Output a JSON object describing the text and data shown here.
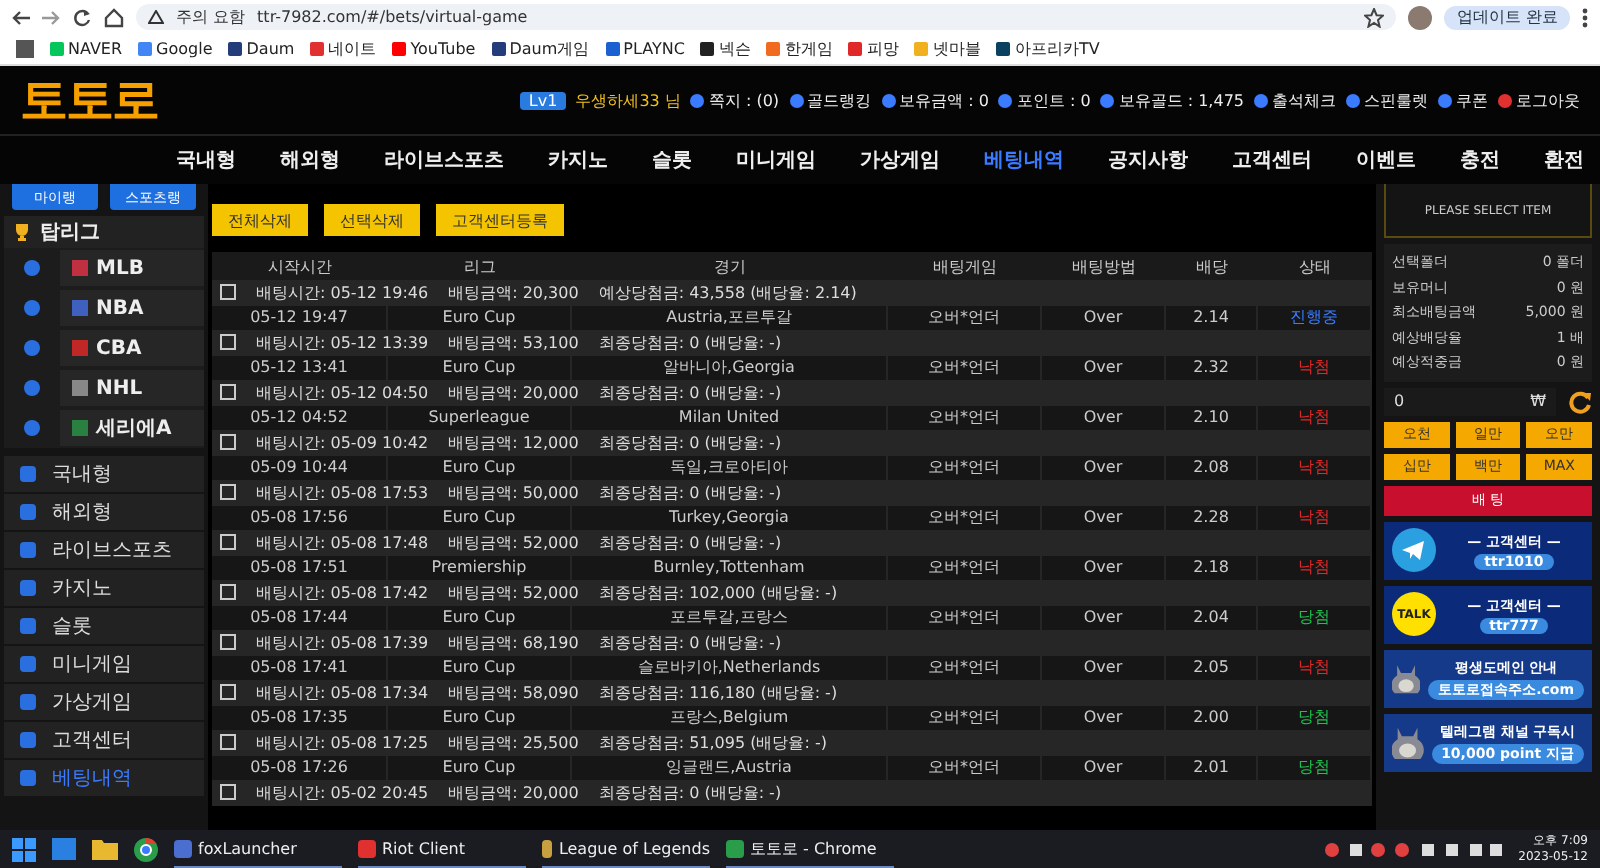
{
  "browser": {
    "security": "주의 요함",
    "url": "ttr-7982.com/#/bets/virtual-game",
    "update_button": "업데이트 완료"
  },
  "bookmarks": [
    "NAVER",
    "Google",
    "Daum",
    "네이트",
    "YouTube",
    "Daum게임",
    "PLAYNC",
    "넥슨",
    "한게임",
    "피망",
    "넷마블",
    "아프리카TV"
  ],
  "site": {
    "logo": "토토로",
    "level": "Lv1",
    "user": "우생하세33 님",
    "links": [
      {
        "text": "쪽지 : (0)",
        "kind": "mail"
      },
      {
        "text": "골드랭킹",
        "kind": "rank"
      },
      {
        "text": "보유금액 : 0",
        "kind": "coin"
      },
      {
        "text": "포인트 : 0",
        "kind": "coin"
      },
      {
        "text": "보유골드 : 1,475",
        "kind": "coin"
      },
      {
        "text": "출석체크",
        "kind": "calendar"
      },
      {
        "text": "스핀룰렛",
        "kind": "spin"
      },
      {
        "text": "쿠폰",
        "kind": "ticket"
      },
      {
        "text": "로그아웃",
        "kind": "power"
      }
    ]
  },
  "nav": [
    {
      "label": "국내형",
      "selected": false
    },
    {
      "label": "해외형",
      "selected": false
    },
    {
      "label": "라이브스포츠",
      "selected": false
    },
    {
      "label": "카지노",
      "selected": false
    },
    {
      "label": "슬롯",
      "selected": false
    },
    {
      "label": "미니게임",
      "selected": false
    },
    {
      "label": "가상게임",
      "selected": false
    },
    {
      "label": "베팅내역",
      "selected": true
    },
    {
      "label": "공지사항",
      "selected": false
    },
    {
      "label": "고객센터",
      "selected": false
    },
    {
      "label": "이벤트",
      "selected": false
    },
    {
      "label": "충전",
      "selected": false
    },
    {
      "label": "환전",
      "selected": false
    }
  ],
  "sidebar": {
    "buttons": [
      "마이랭",
      "스포츠랭"
    ],
    "title": "탑리그",
    "leagues": [
      "MLB",
      "NBA",
      "CBA",
      "NHL",
      "세리에A"
    ],
    "menu": [
      {
        "label": "국내형",
        "selected": false
      },
      {
        "label": "해외형",
        "selected": false
      },
      {
        "label": "라이브스포츠",
        "selected": false
      },
      {
        "label": "카지노",
        "selected": false
      },
      {
        "label": "슬롯",
        "selected": false
      },
      {
        "label": "미니게임",
        "selected": false
      },
      {
        "label": "가상게임",
        "selected": false
      },
      {
        "label": "고객센터",
        "selected": false
      },
      {
        "label": "베팅내역",
        "selected": true
      }
    ]
  },
  "actions": [
    "전체삭제",
    "선택삭제",
    "고객센터등록"
  ],
  "table": {
    "columns": [
      "시작시간",
      "리그",
      "경기",
      "배팅게임",
      "배팅방법",
      "배당",
      "상태"
    ],
    "bets": [
      {
        "checked": false,
        "summary": [
          "배팅시간: 05-12 19:46",
          "배팅금액: 20,300",
          "예상당첨금: 43,558 (배당율: 2.14)"
        ],
        "time": "05-12 19:47",
        "league": "Euro Cup",
        "match": "Austria,포르투갈",
        "game": "오버*언더",
        "pick": "Over",
        "odds": "2.14",
        "status": "진행중",
        "color": "#3a7bff"
      },
      {
        "checked": false,
        "summary": [
          "배팅시간: 05-12 13:39",
          "배팅금액: 53,100",
          "최종당첨금: 0 (배당율: -)"
        ],
        "time": "05-12 13:41",
        "league": "Euro Cup",
        "match": "알바니아,Georgia",
        "game": "오버*언더",
        "pick": "Over",
        "odds": "2.32",
        "status": "낙첨",
        "color": "#e02828"
      },
      {
        "checked": false,
        "summary": [
          "배팅시간: 05-12 04:50",
          "배팅금액: 20,000",
          "최종당첨금: 0 (배당율: -)"
        ],
        "time": "05-12 04:52",
        "league": "Superleague",
        "match": "Milan United",
        "game": "오버*언더",
        "pick": "Over",
        "odds": "2.10",
        "status": "낙첨",
        "color": "#e02828"
      },
      {
        "checked": false,
        "summary": [
          "배팅시간: 05-09 10:42",
          "배팅금액: 12,000",
          "최종당첨금: 0 (배당율: -)"
        ],
        "time": "05-09 10:44",
        "league": "Euro Cup",
        "match": "독일,크로아티아",
        "game": "오버*언더",
        "pick": "Over",
        "odds": "2.08",
        "status": "낙첨",
        "color": "#e02828"
      },
      {
        "checked": false,
        "summary": [
          "배팅시간: 05-08 17:53",
          "배팅금액: 50,000",
          "최종당첨금: 0 (배당율: -)"
        ],
        "time": "05-08 17:56",
        "league": "Euro Cup",
        "match": "Turkey,Georgia",
        "game": "오버*언더",
        "pick": "Over",
        "odds": "2.28",
        "status": "낙첨",
        "color": "#e02828"
      },
      {
        "checked": false,
        "summary": [
          "배팅시간: 05-08 17:48",
          "배팅금액: 52,000",
          "최종당첨금: 0 (배당율: -)"
        ],
        "time": "05-08 17:51",
        "league": "Premiership",
        "match": "Burnley,Tottenham",
        "game": "오버*언더",
        "pick": "Over",
        "odds": "2.18",
        "status": "낙첨",
        "color": "#e02828"
      },
      {
        "checked": false,
        "summary": [
          "배팅시간: 05-08 17:42",
          "배팅금액: 52,000",
          "최종당첨금: 102,000 (배당율: -)"
        ],
        "time": "05-08 17:44",
        "league": "Euro Cup",
        "match": "포르투갈,프랑스",
        "game": "오버*언더",
        "pick": "Over",
        "odds": "2.04",
        "status": "당첨",
        "color": "#20c050"
      },
      {
        "checked": false,
        "summary": [
          "배팅시간: 05-08 17:39",
          "배팅금액: 68,190",
          "최종당첨금: 0 (배당율: -)"
        ],
        "time": "05-08 17:41",
        "league": "Euro Cup",
        "match": "슬로바키아,Netherlands",
        "game": "오버*언더",
        "pick": "Over",
        "odds": "2.05",
        "status": "낙첨",
        "color": "#e02828"
      },
      {
        "checked": false,
        "summary": [
          "배팅시간: 05-08 17:34",
          "배팅금액: 58,090",
          "최종당첨금: 116,180 (배당율: -)"
        ],
        "time": "05-08 17:35",
        "league": "Euro Cup",
        "match": "프랑스,Belgium",
        "game": "오버*언더",
        "pick": "Over",
        "odds": "2.00",
        "status": "당첨",
        "color": "#20c050"
      },
      {
        "checked": false,
        "summary": [
          "배팅시간: 05-08 17:25",
          "배팅금액: 25,500",
          "최종당첨금: 51,095 (배당율: -)"
        ],
        "time": "05-08 17:26",
        "league": "Euro Cup",
        "match": "잉글랜드,Austria",
        "game": "오버*언더",
        "pick": "Over",
        "odds": "2.01",
        "status": "당첨",
        "color": "#20c050"
      },
      {
        "checked": false,
        "summary": [
          "배팅시간: 05-02 20:45",
          "배팅금액: 20,000",
          "최종당첨금: 0 (배당율: -)"
        ]
      }
    ]
  },
  "betslip": {
    "prompt": "PLEASE SELECT ITEM",
    "summary": [
      {
        "label": "선택폴더",
        "value": "0",
        "unit": "폴더"
      },
      {
        "label": "보유머니",
        "value": "0",
        "unit": "원"
      },
      {
        "label": "최소배팅금액",
        "value": "5,000",
        "unit": "원"
      },
      {
        "label": "예상배당율",
        "value": "1",
        "unit": "배"
      },
      {
        "label": "예상적중금",
        "value": "0",
        "unit": "원"
      }
    ],
    "amount": "0",
    "currency": "₩",
    "chips": [
      "오천",
      "일만",
      "오만",
      "십만",
      "백만",
      "MAX"
    ],
    "bet_button": "배 팅"
  },
  "banners": [
    {
      "kind": "telegram",
      "lines": [
        "— 고객센터 —",
        "ttr1010"
      ]
    },
    {
      "kind": "kakao",
      "badge": "TALK",
      "lines": [
        "— 고객센터 —",
        "ttr777"
      ]
    },
    {
      "kind": "mascot",
      "lines": [
        "평생도메인 안내",
        "토토로접속주소.com"
      ]
    },
    {
      "kind": "mascot",
      "lines": [
        "텔레그램 채널 구독시",
        "10,000 point 지급"
      ]
    }
  ],
  "taskbar": {
    "apps": [
      {
        "label": "foxLauncher",
        "kind": "fox"
      },
      {
        "label": "Riot Client",
        "kind": "riot"
      },
      {
        "label": "League of Legends",
        "kind": "lol"
      },
      {
        "label": "토토로 - Chrome",
        "kind": "chrome"
      }
    ],
    "time": "오후 7:09",
    "date": "2023-05-12"
  }
}
